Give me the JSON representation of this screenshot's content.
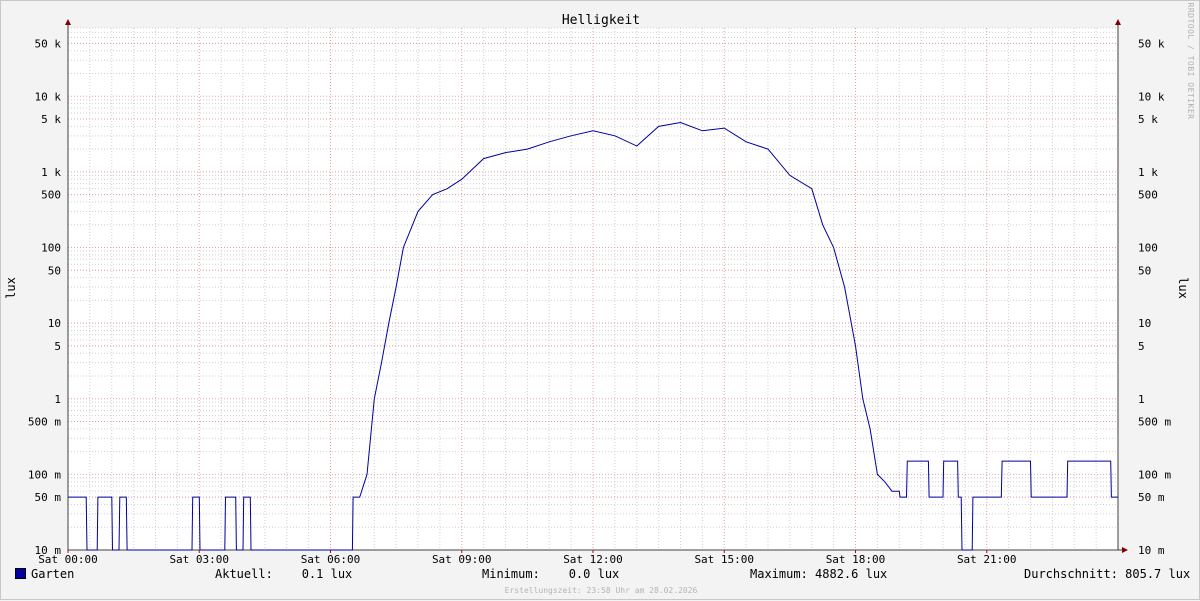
{
  "chart_data": {
    "type": "line",
    "title": "Helligkeit",
    "ylabel": "lux",
    "xlabel": "",
    "y_scale": "log",
    "ylim": [
      10,
      80000
    ],
    "xlim": [
      "00:00",
      "24:00"
    ],
    "grid": true,
    "legend_placement": "bottom-left",
    "colors": {
      "series": "#0000a0",
      "major_grid": "#e8a0a0",
      "minor_grid": "#d0d0d0",
      "arrow": "#800000"
    },
    "x_ticks": [
      "Sat 00:00",
      "Sat 03:00",
      "Sat 06:00",
      "Sat 09:00",
      "Sat 12:00",
      "Sat 15:00",
      "Sat 18:00",
      "Sat 21:00"
    ],
    "y_ticks": [
      {
        "value": 10,
        "label": "10 m"
      },
      {
        "value": 50,
        "label": "50 m"
      },
      {
        "value": 100,
        "label": "100 m"
      },
      {
        "value": 500,
        "label": "500 m"
      },
      {
        "value": 1000,
        "label": "1"
      },
      {
        "value": 5000,
        "label": "5"
      },
      {
        "value": 10000,
        "label": "10"
      },
      {
        "value": 50000,
        "label": "50"
      },
      {
        "value": 100000,
        "label": "100"
      },
      {
        "value": 500000,
        "label": "500"
      },
      {
        "value": 1000000,
        "label": "1 k"
      },
      {
        "value": 5000000,
        "label": "5 k"
      },
      {
        "value": 10000000,
        "label": "10 k"
      },
      {
        "value": 50000000,
        "label": "50 k"
      }
    ],
    "y_units_note": "values in mlux (10 m = 0.01 lux)",
    "series": [
      {
        "name": "Garten",
        "x": [
          "00:00",
          "00:25",
          "00:26",
          "00:40",
          "00:41",
          "01:00",
          "01:01",
          "01:10",
          "01:11",
          "01:20",
          "01:21",
          "02:50",
          "02:51",
          "03:00",
          "03:01",
          "03:35",
          "03:36",
          "03:50",
          "03:51",
          "04:00",
          "04:01",
          "04:10",
          "04:11",
          "06:30",
          "06:31",
          "06:40",
          "06:50",
          "07:00",
          "07:10",
          "07:20",
          "07:30",
          "07:40",
          "08:00",
          "08:20",
          "08:40",
          "09:00",
          "09:30",
          "10:00",
          "10:30",
          "11:00",
          "11:30",
          "12:00",
          "12:30",
          "13:00",
          "13:30",
          "14:00",
          "14:30",
          "15:00",
          "15:30",
          "16:00",
          "16:30",
          "17:00",
          "17:15",
          "17:30",
          "17:45",
          "18:00",
          "18:10",
          "18:20",
          "18:30",
          "18:40",
          "18:50",
          "19:00",
          "19:01",
          "19:10",
          "19:11",
          "19:40",
          "19:41",
          "20:00",
          "20:01",
          "20:20",
          "20:21",
          "20:25",
          "20:26",
          "20:40",
          "20:41",
          "21:20",
          "21:21",
          "22:00",
          "22:01",
          "22:50",
          "22:51",
          "23:50",
          "23:51",
          "24:00"
        ],
        "values": [
          50,
          50,
          10,
          10,
          50,
          50,
          10,
          10,
          50,
          50,
          10,
          10,
          50,
          50,
          10,
          10,
          50,
          50,
          10,
          10,
          50,
          50,
          10,
          10,
          50,
          50,
          100,
          1000,
          3000,
          10000,
          30000,
          100000,
          300000,
          500000,
          600000,
          800000,
          1500000,
          1800000,
          2000000,
          2500000,
          3000000,
          3500000,
          3000000,
          2200000,
          4000000,
          4500000,
          3500000,
          3800000,
          2500000,
          2000000,
          900000,
          600000,
          200000,
          100000,
          30000,
          5000,
          1000,
          400,
          100,
          80,
          60,
          60,
          50,
          50,
          150,
          150,
          50,
          50,
          150,
          150,
          50,
          50,
          10,
          10,
          50,
          50,
          150,
          150,
          50,
          50,
          150,
          150,
          50,
          50
        ]
      }
    ]
  },
  "legend": {
    "series_name": "Garten",
    "current": "Aktuell:    0.1 lux",
    "minimum": "Minimum:    0.0 lux",
    "maximum": "Maximum: 4882.6 lux",
    "average": "Durchschnitt: 805.7 lux"
  },
  "watermark": "RRDTOOL / TOBI OETIKER",
  "created": "Erstellungszeit: 23:58 Uhr am 28.02.2026"
}
